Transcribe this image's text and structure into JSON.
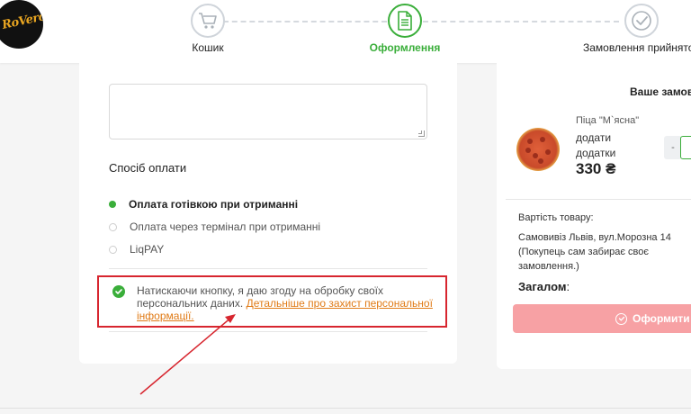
{
  "brand": {
    "logo_text": "RoVero"
  },
  "steps": [
    {
      "label": "Кошик",
      "icon": "cart-icon",
      "active": false
    },
    {
      "label": "Оформлення",
      "icon": "document-icon",
      "active": true
    },
    {
      "label": "Замовлення прийнято",
      "icon": "check-circle-icon",
      "active": false
    }
  ],
  "colors": {
    "accent": "#3aae3a",
    "link": "#e07b17",
    "highlight": "#d7262f",
    "button": "#f7a1a4"
  },
  "payment": {
    "title": "Спосіб оплати",
    "options": [
      {
        "label": "Оплата готівкою при отриманні",
        "selected": true
      },
      {
        "label": "Оплата через термінал при отриманні",
        "selected": false
      },
      {
        "label": "LiqPAY",
        "selected": false
      }
    ]
  },
  "consent": {
    "text": "Натискаючи кнопку, я даю згоду на обробку своїх персональних даних.",
    "link": "Детальніше про захист персональної інформації."
  },
  "order": {
    "title": "Ваше замов",
    "item": {
      "name": "Піца \"М`ясна\"",
      "add_line_1": "додати",
      "add_line_2": "додатки",
      "price": "330 ₴",
      "qty_minus": "-"
    },
    "cost_label": "Вартість товару:",
    "pickup_text": "Самовивіз Львів, вул.Морозна 14 (Покупець сам забирає своє замовлення.)",
    "total_label": "Загалом",
    "total_colon": ":",
    "submit_label": "Оформити за"
  }
}
